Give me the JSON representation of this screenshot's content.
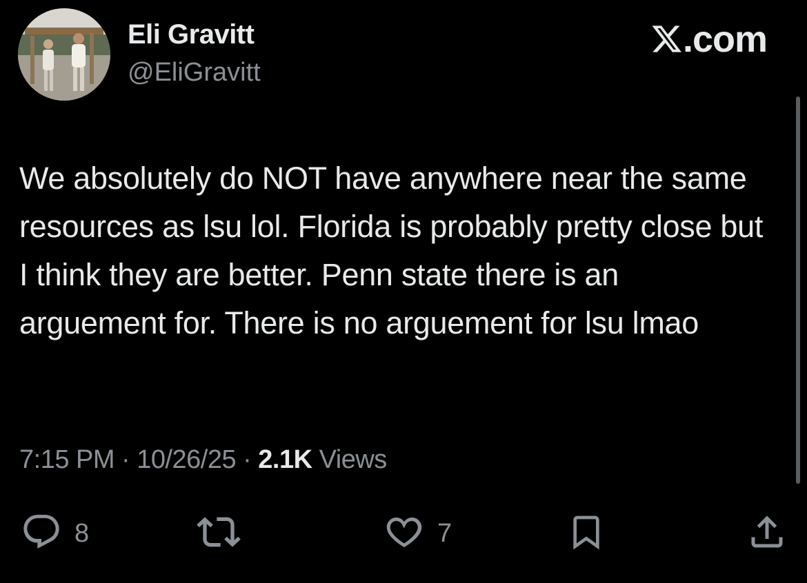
{
  "author": {
    "display_name": "Eli Gravitt",
    "handle": "@EliGravitt"
  },
  "brand": {
    "label": ".com",
    "icon": "x-logo-icon"
  },
  "tweet": {
    "text": "We absolutely do NOT have anywhere near the same resources as lsu lol. Florida is probably pretty close but I think they are better. Penn state there is an arguement for. There is no arguement for lsu lmao"
  },
  "meta": {
    "time": "7:15 PM",
    "separator": "·",
    "date": "10/26/25",
    "views_count": "2.1K",
    "views_label": "Views"
  },
  "actions": {
    "reply": {
      "icon": "reply-icon",
      "count": "8"
    },
    "repost": {
      "icon": "repost-icon",
      "count": ""
    },
    "like": {
      "icon": "heart-icon",
      "count": "7"
    },
    "bookmark": {
      "icon": "bookmark-icon"
    },
    "share": {
      "icon": "share-icon"
    }
  },
  "colors": {
    "background": "#000000",
    "primary_text": "#e7e9ea",
    "secondary_text": "#8b9096"
  }
}
